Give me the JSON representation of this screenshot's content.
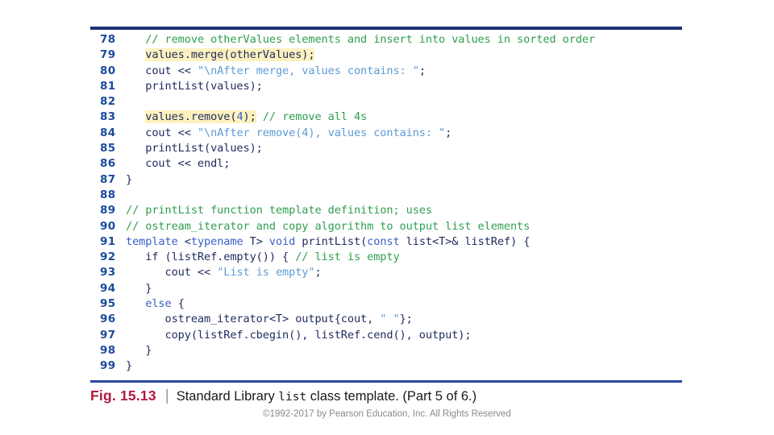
{
  "slide": {
    "background_color": "#ffffff",
    "rule_color_top": "#1f3072",
    "rule_color_bottom": "#2a4a9c"
  },
  "code": {
    "language": "C++",
    "highlight_color": "#fdf2bf",
    "comment_color": "#2f9e4f",
    "string_color": "#5b9bd5",
    "keyword_color": "#3a5fc8",
    "code_color": "#1f2a5e",
    "lineno_color": "#1b4a9c",
    "lines": [
      {
        "n": "78",
        "text": "   // remove otherValues elements and insert into values in sorted order"
      },
      {
        "n": "79",
        "text": "   values.merge(otherValues);"
      },
      {
        "n": "80",
        "text": "   cout << \"\\nAfter merge, values contains: \";"
      },
      {
        "n": "81",
        "text": "   printList(values);"
      },
      {
        "n": "82",
        "text": ""
      },
      {
        "n": "83",
        "text": "   values.remove(4); // remove all 4s"
      },
      {
        "n": "84",
        "text": "   cout << \"\\nAfter remove(4), values contains: \";"
      },
      {
        "n": "85",
        "text": "   printList(values);"
      },
      {
        "n": "86",
        "text": "   cout << endl;"
      },
      {
        "n": "87",
        "text": "}"
      },
      {
        "n": "88",
        "text": ""
      },
      {
        "n": "89",
        "text": "// printList function template definition; uses"
      },
      {
        "n": "90",
        "text": "// ostream_iterator and copy algorithm to output list elements"
      },
      {
        "n": "91",
        "text": "template <typename T> void printList(const list<T>& listRef) {"
      },
      {
        "n": "92",
        "text": "   if (listRef.empty()) { // list is empty"
      },
      {
        "n": "93",
        "text": "      cout << \"List is empty\";"
      },
      {
        "n": "94",
        "text": "   }"
      },
      {
        "n": "95",
        "text": "   else {"
      },
      {
        "n": "96",
        "text": "      ostream_iterator<T> output{cout, \" \"};"
      },
      {
        "n": "97",
        "text": "      copy(listRef.cbegin(), listRef.cend(), output);"
      },
      {
        "n": "98",
        "text": "   }"
      },
      {
        "n": "99",
        "text": "}"
      }
    ]
  },
  "caption": {
    "figure_number": "Fig. 15.13",
    "separator": "|",
    "text_before": "Standard Library ",
    "mono_term": "list",
    "text_after": " class template. (Part 5 of 6.)",
    "figure_number_color": "#b01c3e"
  },
  "footer": {
    "copyright": "©1992-2017 by Pearson Education, Inc. All Rights Reserved"
  }
}
